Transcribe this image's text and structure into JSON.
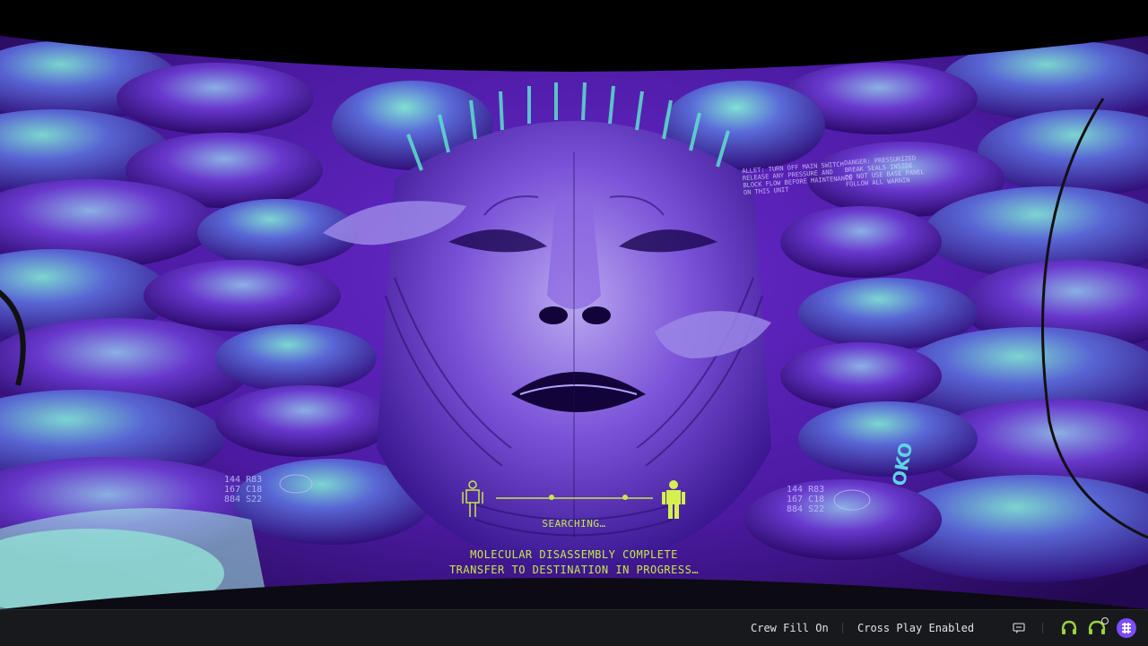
{
  "hud": {
    "status": "SEARCHING…",
    "message_line1": "MOLECULAR DISASSEMBLY COMPLETE",
    "message_line2": "TRANSFER TO DESTINATION IN PROGRESS…",
    "readout_left": [
      "144  R83",
      "167  C18",
      "884  S22"
    ],
    "readout_right": [
      "144  R83",
      "167  C18",
      "884  S22"
    ],
    "warning_text_1": "ALLET: TURN OFF MAIN SWITCH\nRELEASE ANY PRESSURE AND\nBLOCK FLOW BEFORE MAINTENANCE\nON THIS UNIT",
    "warning_text_2": "DANGER: PRESSURIZED\nBREAK SEALS INSIDE\nDO NOT USE BASE PANEL\nFOLLOW ALL WARNIN",
    "logo": "OKO"
  },
  "bottom_bar": {
    "crew_fill": "Crew Fill On",
    "cross_play": "Cross Play Enabled",
    "icons": [
      "chat-icon",
      "headset-icon",
      "headset-settings-icon",
      "app-logo-icon"
    ]
  },
  "colors": {
    "hud_accent": "#c8e84a",
    "scene_purple": "#5a1fb0",
    "scene_cyan": "#4fd6c8",
    "bar_bg": "#18191c"
  }
}
